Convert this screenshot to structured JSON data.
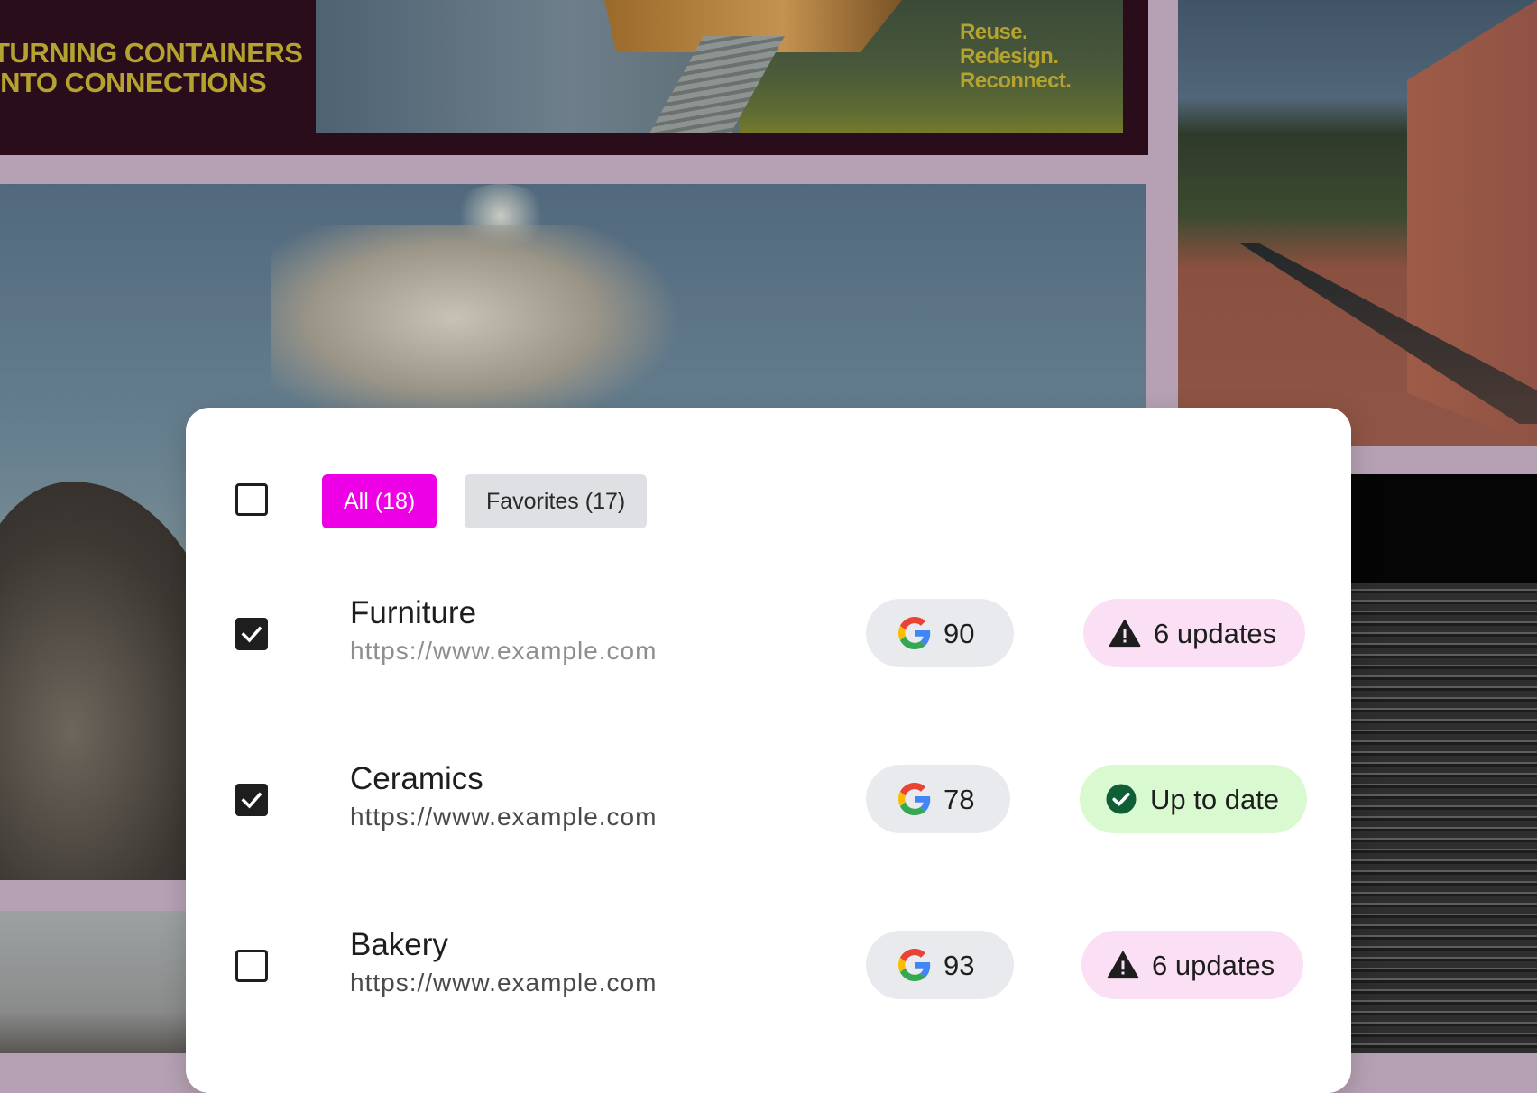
{
  "background": {
    "banner": {
      "title": "TURNING CONTAINERS\nINTO CONNECTIONS",
      "tagline": "Reuse.\nRedesign.\nReconnect."
    }
  },
  "card": {
    "filters": [
      {
        "label": "All (18)",
        "active": true
      },
      {
        "label": "Favorites (17)",
        "active": false
      }
    ],
    "rows": [
      {
        "name": "Furniture",
        "url": "https://www.example.com",
        "checked": true,
        "score": "90",
        "status": "6 updates",
        "status_type": "warning"
      },
      {
        "name": "Ceramics",
        "url": "https://www.example.com",
        "checked": true,
        "score": "78",
        "status": "Up to date",
        "status_type": "ok"
      },
      {
        "name": "Bakery",
        "url": "https://www.example.com",
        "checked": false,
        "score": "93",
        "status": "6 updates",
        "status_type": "warning"
      }
    ]
  },
  "colors": {
    "accent": "#ee00e6",
    "warning_bg": "#fadff5",
    "ok_bg": "#d9fad0",
    "ok_icon": "#0f5e35",
    "pill_bg": "#e9eaed",
    "banner_text": "#b5a330",
    "url_first_row": "#8e8e8e",
    "url_other_rows": "#4a4a4a"
  },
  "icons": {
    "score": "google-g-icon",
    "warning": "warning-triangle-icon",
    "ok": "check-circle-icon",
    "checkbox_checked": "checkmark-icon"
  }
}
